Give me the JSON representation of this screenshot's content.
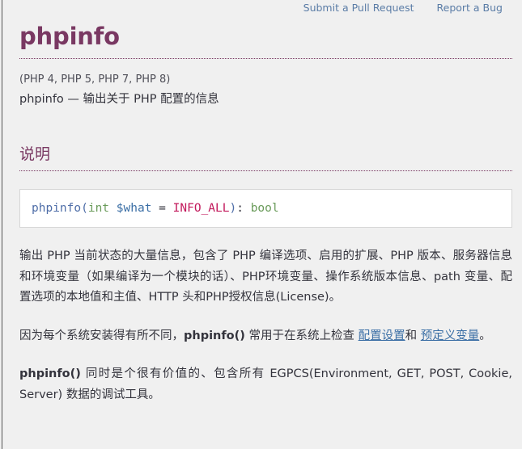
{
  "topbar": {
    "links": [
      {
        "label": "Submit a Pull Request",
        "name": "submit-pull-request-link"
      },
      {
        "label": "Report a Bug",
        "name": "report-a-bug-link"
      }
    ]
  },
  "page": {
    "title": "phpinfo",
    "verinfo": "(PHP 4, PHP 5, PHP 7, PHP 8)",
    "purpose": "phpinfo — 输出关于 PHP 配置的信息"
  },
  "section": {
    "heading": "说明"
  },
  "synopsis": {
    "methodname": "phpinfo",
    "open_paren": "(",
    "type": "int",
    "parameter": "$what",
    "equals": "=",
    "initializer": "INFO_ALL",
    "close_paren": ")",
    "colon": ":",
    "return_type": "bool"
  },
  "paragraphs": {
    "p1": "输出 PHP 当前状态的大量信息，包含了 PHP 编译选项、启用的扩展、PHP 版本、服务器信息和环境变量（如果编译为一个模块的话）、PHP环境变量、操作系统版本信息、path 变量、配置选项的本地值和主值、HTTP 头和PHP授权信息(License)。",
    "p2_before": "因为每个系统安装得有所不同，",
    "p2_fn": "phpinfo()",
    "p2_mid": " 常用于在系统上检查 ",
    "p2_link1": "配置设置",
    "p2_and": "和 ",
    "p2_link2": "预定义变量",
    "p2_end": "。",
    "p3_fn": "phpinfo()",
    "p3_text": " 同时是个很有价值的、包含所有 EGPCS(Environment, GET, POST, Cookie, Server) 数据的调试工具。"
  },
  "colors": {
    "page_background": "#f0f0f0",
    "heading": "#793862",
    "link": "#3a6ea5",
    "topbar_link": "#5a7ca6",
    "code_background": "#ffffff",
    "code_border": "#d6d6d6",
    "body_text": "#33333c"
  }
}
